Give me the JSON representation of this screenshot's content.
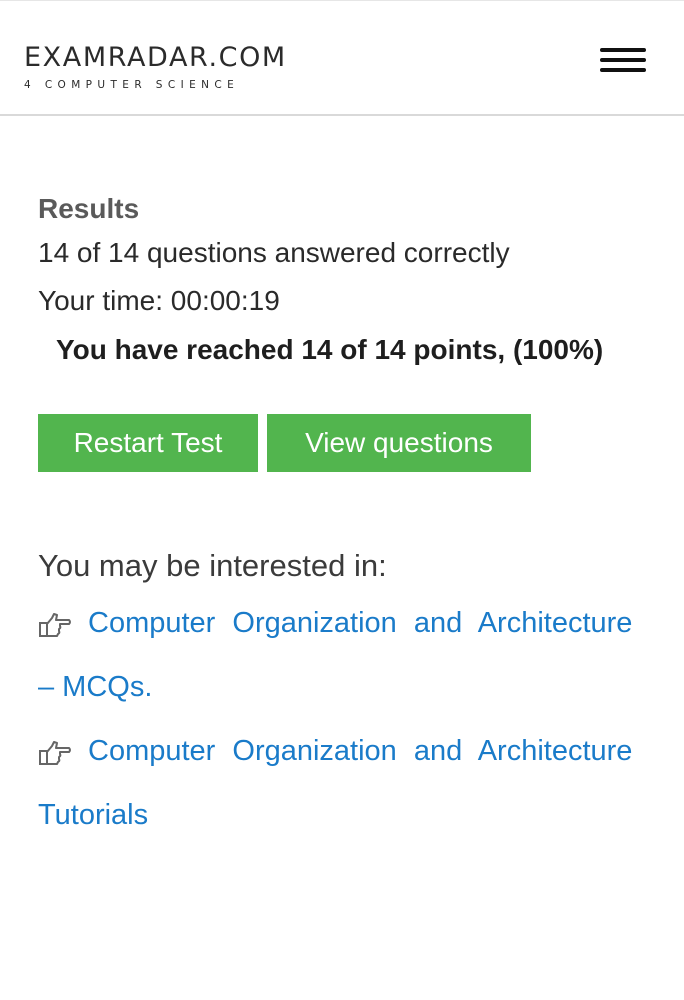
{
  "header": {
    "logo_title": "EXAMRADAR.COM",
    "logo_subtitle": "4 COMPUTER SCIENCE",
    "menu_icon": "hamburger-menu-icon"
  },
  "results": {
    "heading": "Results",
    "correct_text": "14 of 14 questions answered correctly",
    "time_text": "Your time: 00:00:19",
    "points_text": "You have reached 14 of 14 points, (100%)",
    "score_correct": 14,
    "score_total": 14,
    "percent": 100
  },
  "buttons": {
    "restart_label": "Restart Test",
    "view_label": "View questions",
    "color": "#52b54e"
  },
  "related": {
    "heading": "You may be interested in:",
    "icon": "pointing-hand-icon",
    "link_color": "#1a7bc9",
    "links": [
      {
        "line1": "Computer Organization and Architecture",
        "line2": "– MCQs."
      },
      {
        "line1": "Computer Organization and Architecture",
        "line2": "Tutorials"
      }
    ]
  }
}
